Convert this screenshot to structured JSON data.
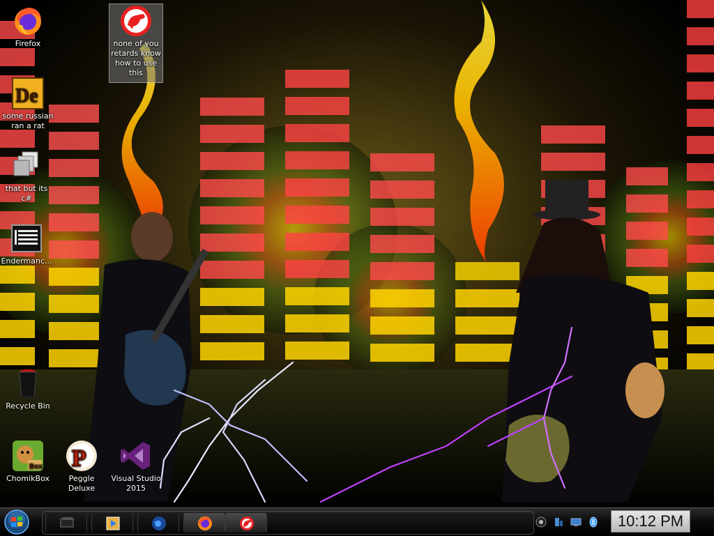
{
  "desktop": {
    "icons": [
      {
        "label": "Firefox",
        "icon": "firefox-icon"
      },
      {
        "label": "some russian ran a rat",
        "icon": "de-app-icon"
      },
      {
        "label": "that but its c#",
        "icon": "stacked-windows-icon"
      },
      {
        "label": "Endermanc...",
        "icon": "list-app-icon"
      },
      {
        "label": "none of you retards know how to use this",
        "icon": "red-dinosaur-icon"
      },
      {
        "label": "Recycle Bin",
        "icon": "recycle-bin-icon"
      },
      {
        "label": "ChomikBox",
        "icon": "chomikbox-icon"
      },
      {
        "label": "Peggle Deluxe",
        "icon": "peggle-icon"
      },
      {
        "label": "Visual Studio 2015",
        "icon": "visual-studio-icon"
      }
    ]
  },
  "taskbar": {
    "start": {
      "icon": "windows-start-orb-icon"
    },
    "buttons": [
      {
        "icon": "show-desktop-icon"
      },
      {
        "icon": "media-player-icon"
      },
      {
        "icon": "globe-browser-icon"
      },
      {
        "icon": "firefox-icon"
      },
      {
        "icon": "red-dinosaur-icon"
      }
    ],
    "tray": [
      {
        "icon": "record-icon"
      },
      {
        "icon": "network-icon"
      },
      {
        "icon": "monitor-icon"
      },
      {
        "icon": "volume-icon"
      }
    ],
    "clock": "10:12 PM"
  },
  "colors": {
    "taskbar_bg": "#0c0c0c",
    "clock_bg": "#d0d0d0",
    "wallpaper_red": "#ff4a4a",
    "wallpaper_yellow": "#ffdd00",
    "lightning_purple": "#c040ff"
  }
}
